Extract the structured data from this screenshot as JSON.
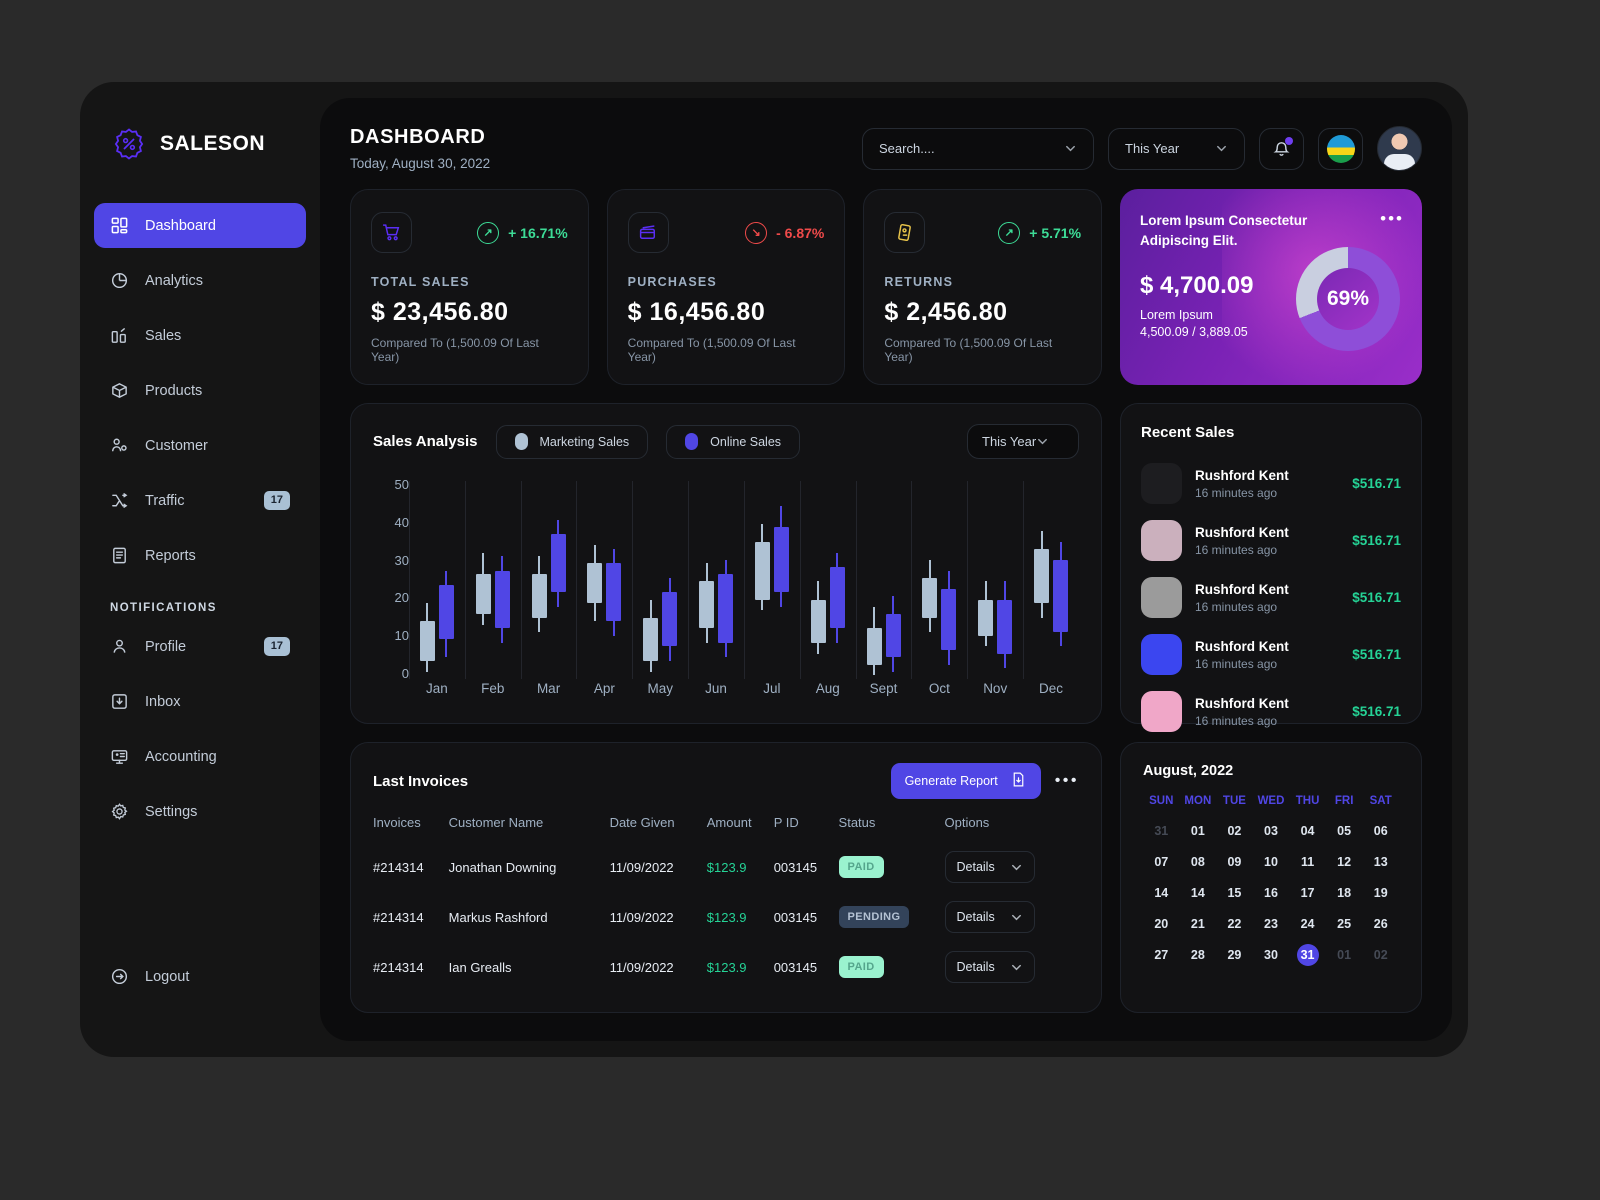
{
  "brand": {
    "name": "SALESON",
    "logo_icon": "percent-badge-icon"
  },
  "sidebar": {
    "items": [
      {
        "label": "Dashboard",
        "icon": "grid-icon",
        "badge": null,
        "active": true
      },
      {
        "label": "Analytics",
        "icon": "pie-chart-icon",
        "badge": null,
        "active": false
      },
      {
        "label": "Sales",
        "icon": "sales-chart-icon",
        "badge": null,
        "active": false
      },
      {
        "label": "Products",
        "icon": "box-icon",
        "badge": null,
        "active": false
      },
      {
        "label": "Customer",
        "icon": "customer-icon",
        "badge": null,
        "active": false
      },
      {
        "label": "Traffic",
        "icon": "traffic-icon",
        "badge": "17",
        "active": false
      },
      {
        "label": "Reports",
        "icon": "report-icon",
        "badge": null,
        "active": false
      }
    ],
    "section_label": "NOTIFICATIONS",
    "notification_items": [
      {
        "label": "Profile",
        "icon": "user-icon",
        "badge": "17"
      },
      {
        "label": "Inbox",
        "icon": "inbox-icon",
        "badge": null
      },
      {
        "label": "Accounting",
        "icon": "monitor-user-icon",
        "badge": null
      },
      {
        "label": "Settings",
        "icon": "gear-icon",
        "badge": null
      }
    ],
    "logout": {
      "label": "Logout",
      "icon": "logout-icon"
    }
  },
  "header": {
    "title": "DASHBOARD",
    "date": "Today, August 30, 2022",
    "search_placeholder": "Search....",
    "search_value": "",
    "period_value": "This Year",
    "bell_icon": "bell-icon",
    "flag_icon": "flag-icon",
    "avatar_icon": "user-avatar"
  },
  "stats": [
    {
      "icon": "shopping-cart-icon",
      "delta": "+ 16.71%",
      "direction": "up",
      "label": "TOTAL SALES",
      "value": "$ 23,456.80",
      "sub": "Compared To (1,500.09 Of Last Year)"
    },
    {
      "icon": "credit-cards-icon",
      "delta": "- 6.87%",
      "direction": "down",
      "label": "PURCHASES",
      "value": "$ 16,456.80",
      "sub": "Compared To (1,500.09 Of Last Year)"
    },
    {
      "icon": "ticket-icon",
      "delta": "+ 5.71%",
      "direction": "up",
      "label": "RETURNS",
      "value": "$ 2,456.80",
      "sub": "Compared To (1,500.09 Of Last Year)"
    }
  ],
  "promo": {
    "title": "Lorem Ipsum Consectetur Adipiscing Elit.",
    "value": "$ 4,700.09",
    "sub_label": "Lorem Ipsum",
    "sub_value": "4,500.09 / 3,889.05",
    "percent": "69%",
    "percent_number": 69,
    "menu_icon": "more-dots-icon"
  },
  "chart_panel": {
    "title": "Sales Analysis",
    "legend": [
      {
        "label": "Marketing Sales",
        "color": "#afc2d4"
      },
      {
        "label": "Online Sales",
        "color": "#5046e5"
      }
    ],
    "period_value": "This Year"
  },
  "chart_data": {
    "type": "bar",
    "title": "Sales Analysis",
    "xlabel": "",
    "ylabel": "",
    "ylim": [
      -5,
      52
    ],
    "yticks": [
      0,
      10,
      20,
      30,
      40,
      50
    ],
    "grid": true,
    "legend_position": "top",
    "categories": [
      "Jan",
      "Feb",
      "Mar",
      "Apr",
      "May",
      "Jun",
      "Jul",
      "Aug",
      "Sept",
      "Oct",
      "Nov",
      "Dec"
    ],
    "series": [
      {
        "name": "Marketing Sales",
        "color": "#afc2d4",
        "candles": [
          {
            "low": -3,
            "open": 0,
            "close": 11,
            "high": 16
          },
          {
            "low": 10,
            "open": 13,
            "close": 24,
            "high": 30
          },
          {
            "low": 8,
            "open": 12,
            "close": 24,
            "high": 29
          },
          {
            "low": 11,
            "open": 16,
            "close": 27,
            "high": 32
          },
          {
            "low": -3,
            "open": 0,
            "close": 12,
            "high": 17
          },
          {
            "low": 5,
            "open": 9,
            "close": 22,
            "high": 27
          },
          {
            "low": 14,
            "open": 17,
            "close": 33,
            "high": 38
          },
          {
            "low": 2,
            "open": 5,
            "close": 17,
            "high": 22
          },
          {
            "low": -4,
            "open": -1,
            "close": 9,
            "high": 15
          },
          {
            "low": 8,
            "open": 12,
            "close": 23,
            "high": 28
          },
          {
            "low": 4,
            "open": 7,
            "close": 17,
            "high": 22
          },
          {
            "low": 12,
            "open": 16,
            "close": 31,
            "high": 36
          }
        ]
      },
      {
        "name": "Online Sales",
        "color": "#5046e5",
        "candles": [
          {
            "low": 1,
            "open": 6,
            "close": 21,
            "high": 25
          },
          {
            "low": 5,
            "open": 9,
            "close": 25,
            "high": 29
          },
          {
            "low": 15,
            "open": 19,
            "close": 35,
            "high": 39
          },
          {
            "low": 7,
            "open": 11,
            "close": 27,
            "high": 31
          },
          {
            "low": 0,
            "open": 4,
            "close": 19,
            "high": 23
          },
          {
            "low": 1,
            "open": 5,
            "close": 24,
            "high": 28
          },
          {
            "low": 15,
            "open": 19,
            "close": 37,
            "high": 43
          },
          {
            "low": 5,
            "open": 9,
            "close": 26,
            "high": 30
          },
          {
            "low": -3,
            "open": 1,
            "close": 13,
            "high": 18
          },
          {
            "low": -1,
            "open": 3,
            "close": 20,
            "high": 25
          },
          {
            "low": -2,
            "open": 2,
            "close": 17,
            "high": 22
          },
          {
            "low": 4,
            "open": 8,
            "close": 28,
            "high": 33
          }
        ]
      }
    ]
  },
  "recent_sales": {
    "title": "Recent Sales",
    "rows": [
      {
        "name": "Rushford Kent",
        "time": "16 minutes ago",
        "amount": "$516.71",
        "avatar_color": "#1d1d20"
      },
      {
        "name": "Rushford Kent",
        "time": "16 minutes ago",
        "amount": "$516.71",
        "avatar_color": "#cbb0bd"
      },
      {
        "name": "Rushford Kent",
        "time": "16 minutes ago",
        "amount": "$516.71",
        "avatar_color": "#9b9b9b"
      },
      {
        "name": "Rushford Kent",
        "time": "16 minutes ago",
        "amount": "$516.71",
        "avatar_color": "#3b46f0"
      },
      {
        "name": "Rushford Kent",
        "time": "16 minutes ago",
        "amount": "$516.71",
        "avatar_color": "#f0a7c8"
      }
    ]
  },
  "invoices": {
    "title": "Last Invoices",
    "generate_label": "Generate Report",
    "generate_icon": "document-download-icon",
    "menu_icon": "more-dots-icon",
    "columns": [
      "Invoices",
      "Customer Name",
      "Date Given",
      "Amount",
      "P ID",
      "Status",
      "Options"
    ],
    "rows": [
      {
        "invoice": "#214314",
        "customer": "Jonathan Downing",
        "date": "11/09/2022",
        "amount": "$123.9",
        "pid": "003145",
        "status": "PAID",
        "status_type": "paid",
        "option": "Details"
      },
      {
        "invoice": "#214314",
        "customer": "Markus Rashford",
        "date": "11/09/2022",
        "amount": "$123.9",
        "pid": "003145",
        "status": "PENDING",
        "status_type": "pending",
        "option": "Details"
      },
      {
        "invoice": "#214314",
        "customer": "Ian Grealls",
        "date": "11/09/2022",
        "amount": "$123.9",
        "pid": "003145",
        "status": "PAID",
        "status_type": "paid",
        "option": "Details"
      }
    ]
  },
  "calendar": {
    "title": "August, 2022",
    "dow": [
      "SUN",
      "MON",
      "TUE",
      "WED",
      "THU",
      "FRI",
      "SAT"
    ],
    "weeks": [
      [
        {
          "d": "31",
          "muted": true
        },
        {
          "d": "01"
        },
        {
          "d": "02"
        },
        {
          "d": "03"
        },
        {
          "d": "04"
        },
        {
          "d": "05"
        },
        {
          "d": "06"
        }
      ],
      [
        {
          "d": "07"
        },
        {
          "d": "08"
        },
        {
          "d": "09"
        },
        {
          "d": "10"
        },
        {
          "d": "11"
        },
        {
          "d": "12"
        },
        {
          "d": "13"
        }
      ],
      [
        {
          "d": "14"
        },
        {
          "d": "14"
        },
        {
          "d": "15"
        },
        {
          "d": "16"
        },
        {
          "d": "17"
        },
        {
          "d": "18"
        },
        {
          "d": "19"
        }
      ],
      [
        {
          "d": "20"
        },
        {
          "d": "21"
        },
        {
          "d": "22"
        },
        {
          "d": "23"
        },
        {
          "d": "24"
        },
        {
          "d": "25"
        },
        {
          "d": "26"
        }
      ],
      [
        {
          "d": "27"
        },
        {
          "d": "28"
        },
        {
          "d": "29"
        },
        {
          "d": "30"
        },
        {
          "d": "31",
          "sel": true
        },
        {
          "d": "01",
          "muted": true
        },
        {
          "d": "02",
          "muted": true
        }
      ]
    ]
  },
  "colors": {
    "accent": "#5046e5",
    "green": "#25d396",
    "red": "#ef4a4a",
    "muted": "#9fb0c3"
  }
}
